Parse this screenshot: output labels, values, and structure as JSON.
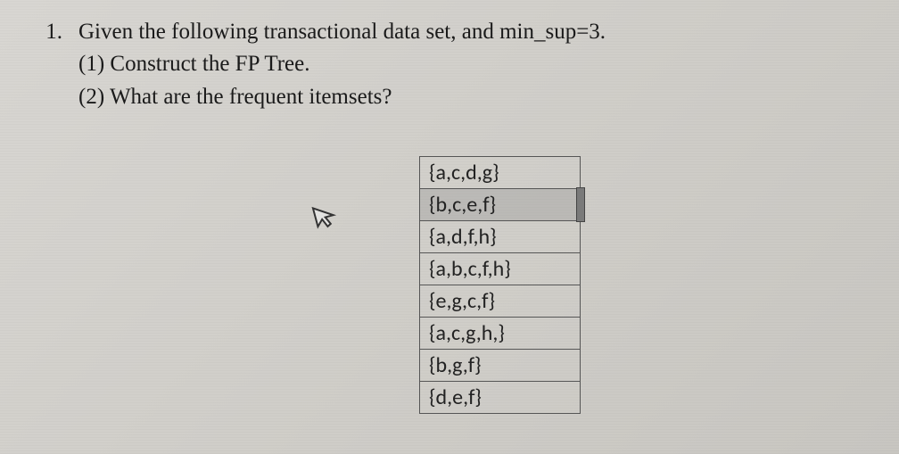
{
  "question": {
    "number": "1.",
    "prompt": "Given the following transactional data set, and min_sup=3.",
    "sub1": "(1) Construct the FP Tree.",
    "sub2": "(2) What are the frequent itemsets?"
  },
  "table": {
    "rows": [
      "{a,c,d,g}",
      "{b,c,e,f}",
      "{a,d,f,h}",
      "{a,b,c,f,h}",
      "{e,g,c,f}",
      "{a,c,g,h,}",
      "{b,g,f}",
      "{d,e,f}"
    ],
    "selectedIndex": 1
  }
}
